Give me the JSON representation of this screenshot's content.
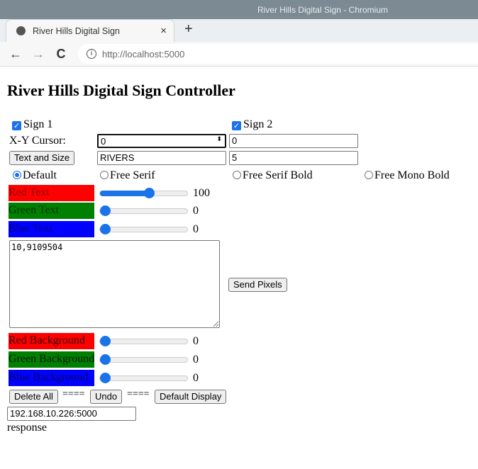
{
  "window": {
    "title": "River Hills Digital Sign - Chromium"
  },
  "tab": {
    "title": "River Hills Digital Sign",
    "close": "×",
    "new_tab": "+"
  },
  "toolbar": {
    "back": "←",
    "forward": "→",
    "reload": "C",
    "url_host": "http://localhost",
    "url_port": ":5000"
  },
  "page": {
    "heading": "River Hills Digital Sign Controller",
    "sign1_label": "Sign 1",
    "sign1_checked": true,
    "sign2_label": "Sign 2",
    "sign2_checked": true,
    "cursor_label": "X-Y Cursor:",
    "cursor_x": "0",
    "cursor_y": "0",
    "text_size_button": "Text and Size",
    "text_value": "RIVERS",
    "size_value": "5",
    "fonts": [
      {
        "label": "Default",
        "selected": true
      },
      {
        "label": "Free Serif",
        "selected": false
      },
      {
        "label": "Free Serif Bold",
        "selected": false
      },
      {
        "label": "Free Mono Bold",
        "selected": false
      }
    ],
    "text_colors": [
      {
        "label": "Red Text",
        "value": "100",
        "fraction": 0.56,
        "color": "#ff0000",
        "text_color": "#8b0000"
      },
      {
        "label": "Green Text",
        "value": "0",
        "fraction": 0,
        "color": "#008000",
        "text_color": "#003300"
      },
      {
        "label": "Blue Text",
        "value": "0",
        "fraction": 0,
        "color": "#0000ff",
        "text_color": "#000080"
      }
    ],
    "pixels_text": "10,9109504",
    "send_pixels_button": "Send Pixels",
    "bg_colors": [
      {
        "label": "Red Background",
        "value": "0",
        "fraction": 0,
        "color": "#ff0000",
        "text_color": "#330000"
      },
      {
        "label": "Green Background",
        "value": "0",
        "fraction": 0,
        "color": "#008000",
        "text_color": "#001a00"
      },
      {
        "label": "Blue Background",
        "value": "0",
        "fraction": 0,
        "color": "#0000ff",
        "text_color": "#000066"
      }
    ],
    "delete_all_button": "Delete All",
    "separator": "====",
    "undo_button": "Undo",
    "default_display_button": "Default Display",
    "address_value": "192.168.10.226:5000",
    "response_text": "response"
  }
}
